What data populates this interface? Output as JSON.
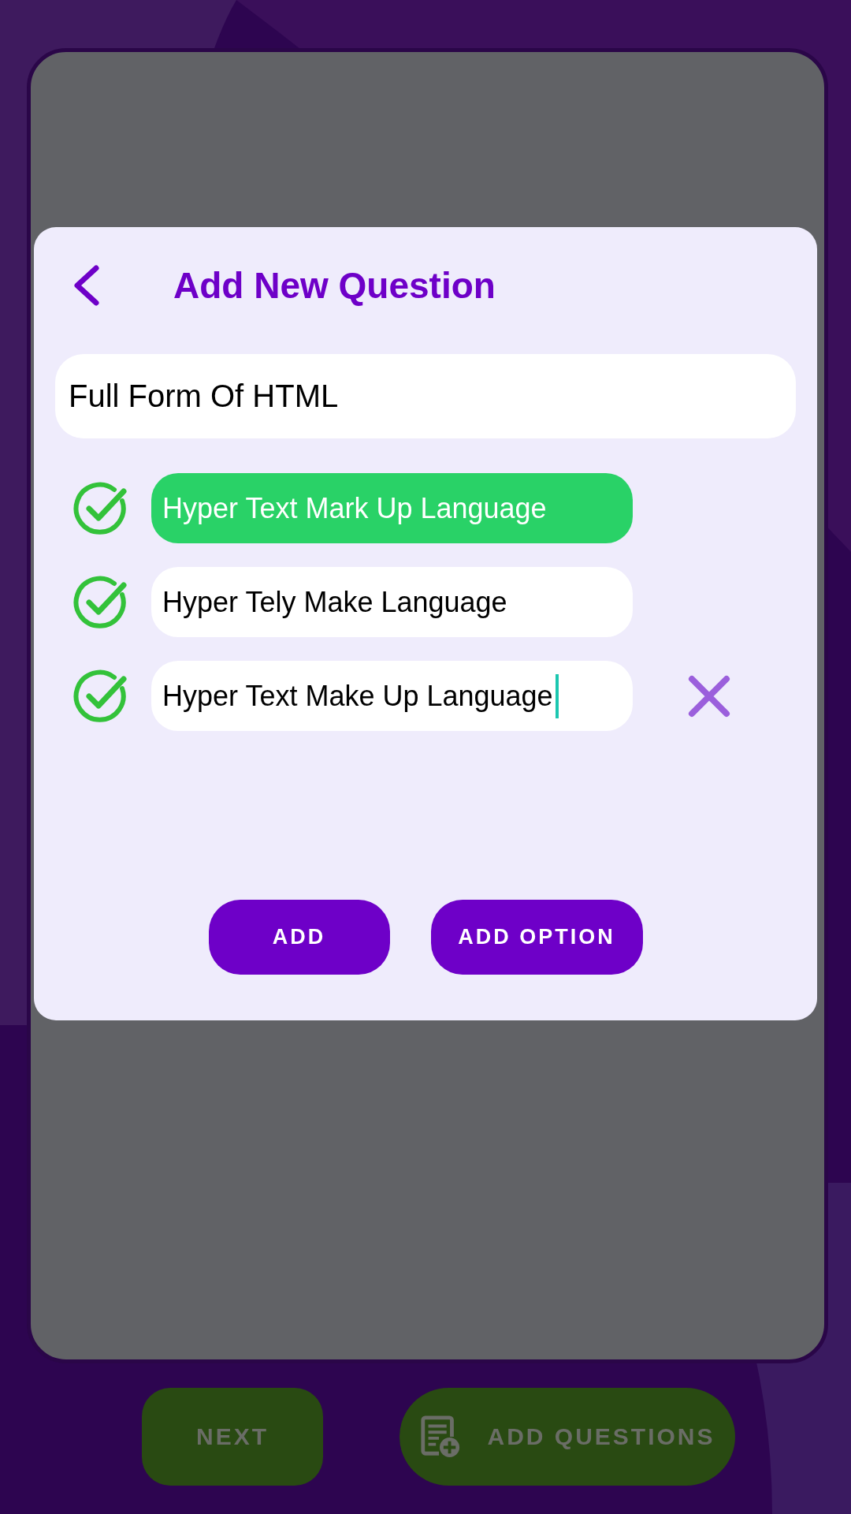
{
  "dialog": {
    "title": "Add New Question",
    "question": {
      "value": "Full Form Of HTML"
    },
    "options": [
      {
        "text": "Hyper Text Mark Up Language",
        "selected": true,
        "focused": false,
        "removable": false
      },
      {
        "text": "Hyper Tely Make Language",
        "selected": false,
        "focused": false,
        "removable": false
      },
      {
        "text": "Hyper Text Make Up Language",
        "selected": false,
        "focused": true,
        "removable": true
      }
    ],
    "buttons": [
      {
        "label": "ADD"
      },
      {
        "label": "ADD OPTION"
      }
    ]
  },
  "bottom_buttons": [
    {
      "label": "NEXT",
      "kind": "plain",
      "disabled": true
    },
    {
      "label": "ADD QUESTIONS",
      "kind": "icon",
      "disabled": true
    }
  ]
}
